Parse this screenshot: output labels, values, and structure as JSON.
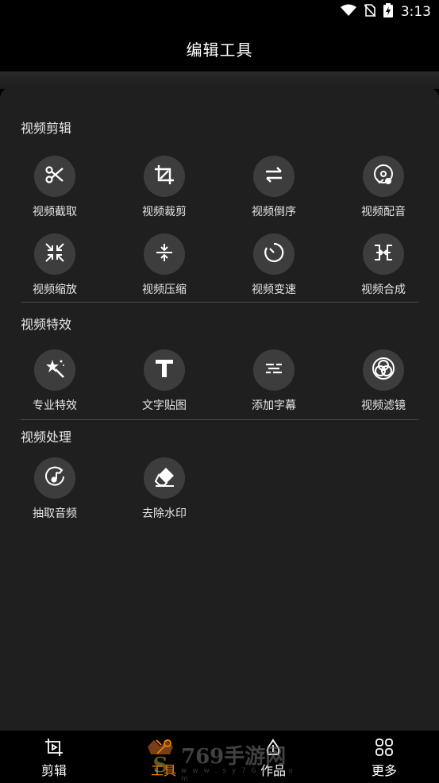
{
  "status_bar": {
    "time": "3:13"
  },
  "header": {
    "title": "编辑工具"
  },
  "sections": [
    {
      "title": "视频剪辑",
      "tools": [
        {
          "label": "视频截取",
          "icon": "scissors-icon"
        },
        {
          "label": "视频裁剪",
          "icon": "crop-icon"
        },
        {
          "label": "视频倒序",
          "icon": "swap-arrows-icon"
        },
        {
          "label": "视频配音",
          "icon": "dubbing-icon"
        },
        {
          "label": "视频缩放",
          "icon": "shrink-icon"
        },
        {
          "label": "视频压缩",
          "icon": "compress-icon"
        },
        {
          "label": "视频变速",
          "icon": "speed-timer-icon"
        },
        {
          "label": "视频合成",
          "icon": "merge-icon"
        }
      ]
    },
    {
      "title": "视频特效",
      "tools": [
        {
          "label": "专业特效",
          "icon": "magic-wand-icon"
        },
        {
          "label": "文字贴图",
          "icon": "text-t-icon"
        },
        {
          "label": "添加字幕",
          "icon": "subtitle-icon"
        },
        {
          "label": "视频滤镜",
          "icon": "filter-circles-icon"
        }
      ]
    },
    {
      "title": "视频处理",
      "tools": [
        {
          "label": "抽取音频",
          "icon": "extract-audio-icon"
        },
        {
          "label": "去除水印",
          "icon": "eraser-icon"
        }
      ]
    }
  ],
  "tabbar": {
    "tabs": [
      {
        "label": "剪辑",
        "icon": "crop-frame-icon"
      },
      {
        "label": "工具",
        "icon": "tools-icon"
      },
      {
        "label": "作品",
        "icon": "works-icon"
      },
      {
        "label": "更多",
        "icon": "grid-more-icon"
      }
    ]
  },
  "watermark": {
    "text": "769手游网",
    "sub": "w w w . s y 7 6 9 . c o m"
  },
  "colors": {
    "background": "#000000",
    "panel": "#1f1f1f",
    "circle": "#3d3d3d",
    "text": "#ffffff"
  }
}
